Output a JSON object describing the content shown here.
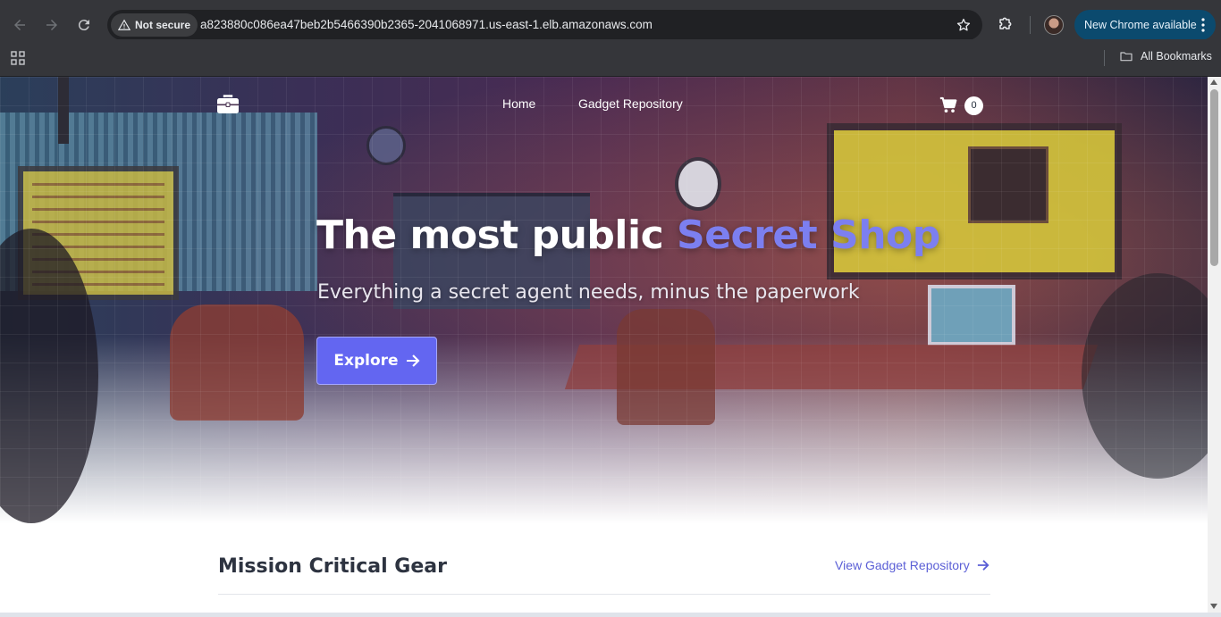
{
  "browser": {
    "security_label": "Not secure",
    "url": "a823880c086ea47beb2b5466390b2365-2041068971.us-east-1.elb.amazonaws.com",
    "update_label": "New Chrome available",
    "bookmarks_label": "All Bookmarks",
    "update_color": "#0b4a6e"
  },
  "site": {
    "nav": {
      "links": [
        "Home",
        "Gadget Repository"
      ],
      "cart_count": "0"
    },
    "hero": {
      "title_main": "The most public ",
      "title_accent": "Secret Shop",
      "subtitle": "Everything a secret agent needs, minus the paperwork",
      "cta_label": "Explore",
      "accent_color": "#6366f1"
    },
    "section": {
      "title": "Mission Critical Gear",
      "link_label": "View Gadget Repository"
    }
  },
  "icons": {
    "back": "arrow-left-icon",
    "forward": "arrow-right-icon",
    "reload": "reload-icon",
    "warning": "warning-icon",
    "bookmark_star": "star-icon",
    "extensions": "puzzle-icon",
    "menu": "more-vert-icon",
    "apps": "apps-grid-icon",
    "folder": "folder-icon",
    "logo": "briefcase-icon",
    "cart": "cart-icon",
    "cta_arrow": "arrow-right-icon"
  }
}
